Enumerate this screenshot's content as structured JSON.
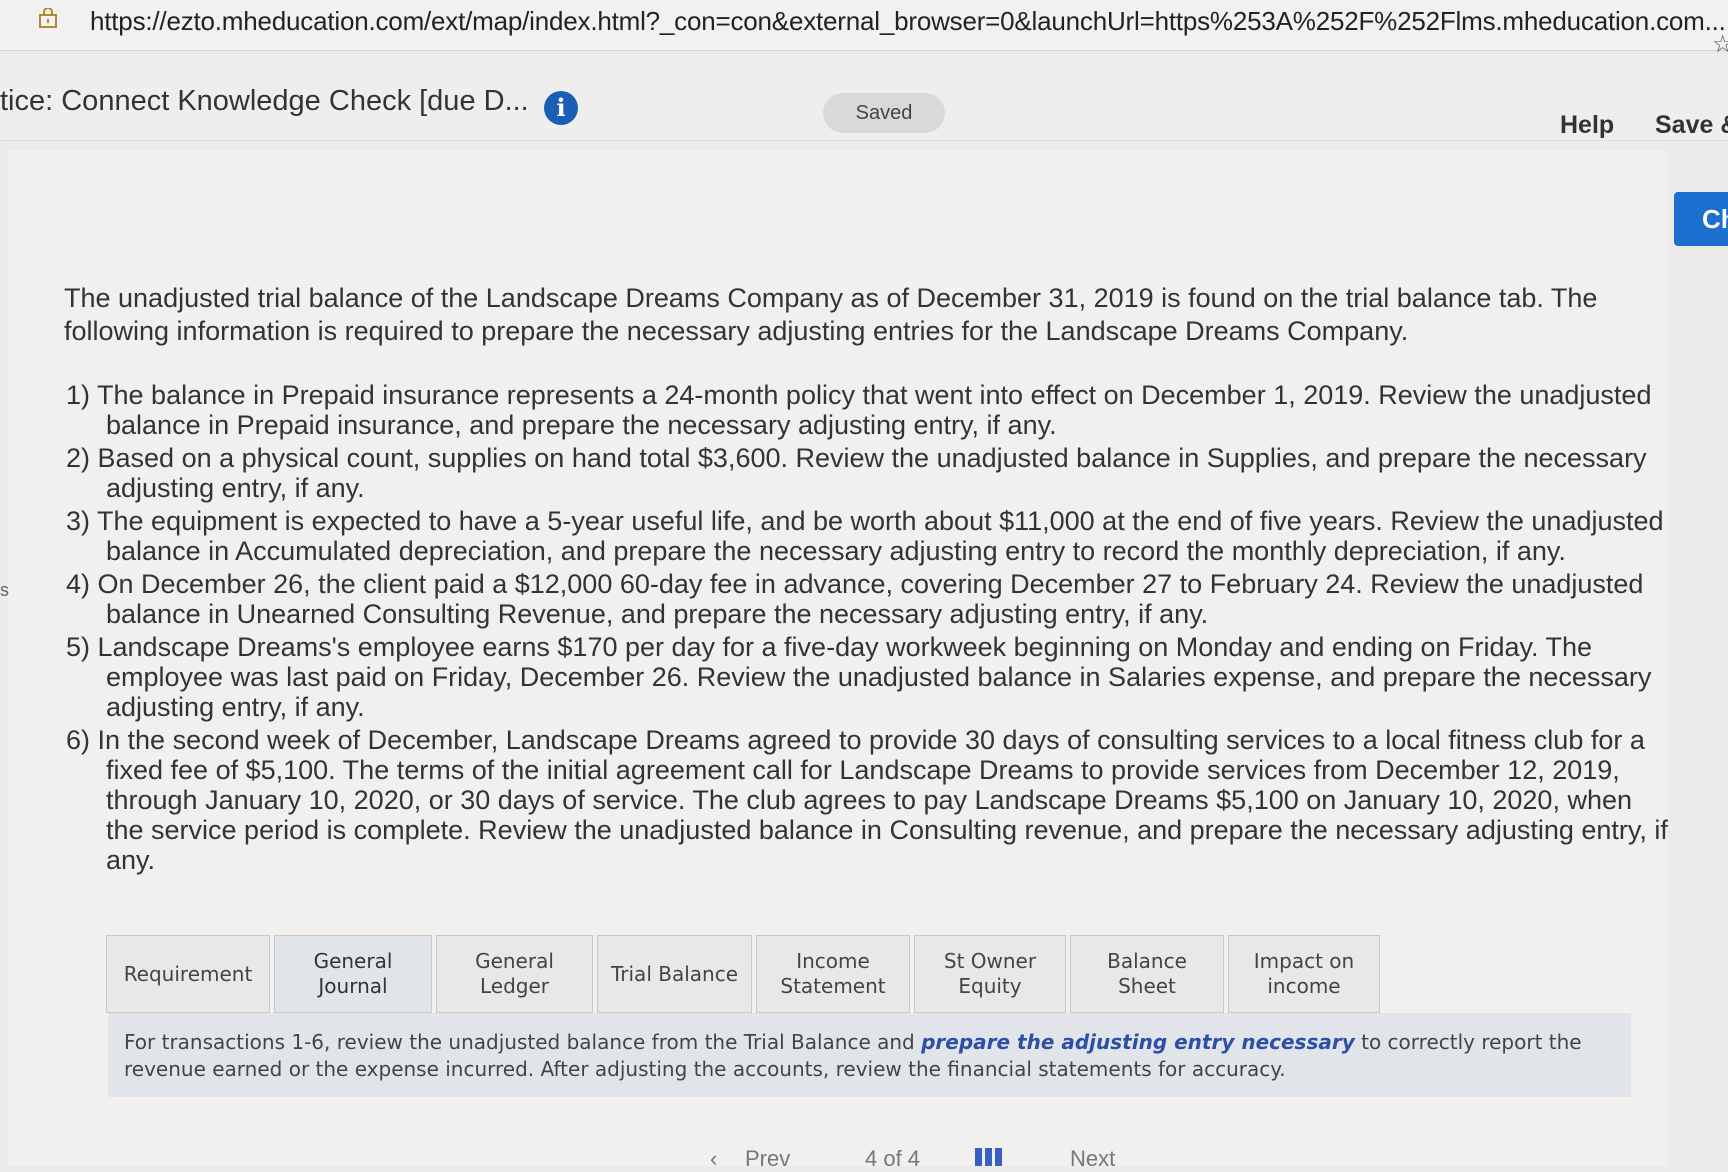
{
  "browser": {
    "url": "https://ezto.mheducation.com/ext/map/index.html?_con=con&external_browser=0&launchUrl=https%253A%252F%252Flms.mheducation.com..."
  },
  "header": {
    "title": "tice: Connect Knowledge Check [due D...",
    "saved_label": "Saved",
    "help_label": "Help",
    "save_exit_label": "Save &",
    "check_label": "Ch"
  },
  "content": {
    "intro": "The unadjusted trial balance of the Landscape Dreams Company as of December 31, 2019 is found on the trial balance tab. The following information is required to prepare the necessary adjusting entries for the Landscape Dreams Company.",
    "side_letter": "s",
    "requirements": [
      "1) The balance in Prepaid insurance represents a 24-month policy that went into effect on December 1, 2019. Review the unadjusted balance in Prepaid insurance, and prepare the necessary adjusting entry, if any.",
      "2) Based on a physical count, supplies on hand total $3,600. Review the unadjusted balance in Supplies, and prepare the necessary adjusting entry, if any.",
      "3) The equipment is expected to have a 5-year useful life, and be worth about $11,000 at the end of five years. Review the unadjusted balance in Accumulated depreciation, and prepare the necessary adjusting entry to record the monthly depreciation, if any.",
      "4) On December 26, the client paid a $12,000 60-day fee in advance, covering December 27 to February 24. Review the unadjusted balance in Unearned Consulting Revenue, and prepare the necessary adjusting entry, if any.",
      "5) Landscape Dreams's employee earns $170 per day for a five-day workweek beginning on Monday and ending on Friday. The employee was last paid on Friday, December 26. Review the unadjusted balance in Salaries expense, and prepare the necessary adjusting entry, if any.",
      "6) In the second week of December, Landscape Dreams agreed to provide 30 days of consulting services to a local fitness club for a fixed fee of $5,100. The terms of the initial agreement call for Landscape Dreams to provide services from December 12, 2019, through January 10, 2020, or 30 days of service. The club agrees to pay Landscape Dreams $5,100 on January 10, 2020, when the service period is complete. Review the unadjusted balance in Consulting revenue, and prepare the necessary adjusting entry, if any."
    ]
  },
  "tabs": [
    {
      "line1": "Requirement",
      "line2": ""
    },
    {
      "line1": "General",
      "line2": "Journal"
    },
    {
      "line1": "General",
      "line2": "Ledger"
    },
    {
      "line1": "Trial Balance",
      "line2": ""
    },
    {
      "line1": "Income",
      "line2": "Statement"
    },
    {
      "line1": "St Owner",
      "line2": "Equity"
    },
    {
      "line1": "Balance Sheet",
      "line2": ""
    },
    {
      "line1": "Impact on",
      "line2": "income"
    }
  ],
  "instructions": {
    "before": "For transactions 1-6, review the unadjusted balance from the Trial Balance and ",
    "emphasis": "prepare the adjusting entry necessary",
    "after": " to correctly report the revenue earned or the expense incurred. After adjusting the accounts, review the financial statements for accuracy."
  },
  "pager": {
    "prev_label": "Prev",
    "position": "4 of 4",
    "next_label": "Next"
  },
  "colors": {
    "accent": "#1a6fcf",
    "info_icon": "#1a5fb4",
    "emphasis_text": "#2d4fa6",
    "instruction_bg": "#e1e5ea"
  }
}
